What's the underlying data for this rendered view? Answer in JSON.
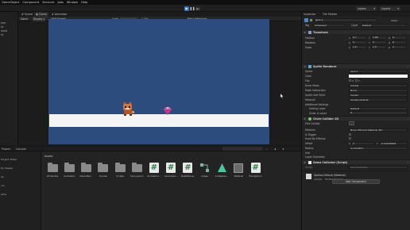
{
  "menubar": [
    "GameObject",
    "Component",
    "Services",
    "Jobs",
    "Window",
    "Help"
  ],
  "toolbar": {
    "layers": "Layers",
    "layout": "Layout",
    "play": "▶",
    "pause": "❚❚",
    "step": "▶|"
  },
  "hierarchy": {
    "items": [
      "ene",
      "ra",
      "ound",
      "ht"
    ]
  },
  "scene": {
    "tabs": [
      {
        "label": "Scene",
        "icon": "#"
      },
      {
        "label": "Game",
        "icon": "◉"
      },
      {
        "label": "Animator",
        "icon": "≣"
      }
    ],
    "game_bar": {
      "display": "Game",
      "display_num": "Display 1",
      "aspect": "16:9 Aspect",
      "scale_label": "Scale",
      "scale_value": "1.25x",
      "play_mode": "Play Unfocused"
    }
  },
  "project": {
    "tabs": [
      "Project",
      "Console"
    ],
    "left_items": [
      "Project Trailer",
      "Dy Sleeps",
      "lar",
      "ors",
      "jects"
    ],
    "breadcrumb": "Assets",
    "assets": [
      {
        "label": "2D Sprites",
        "kind": "folder"
      },
      {
        "label": "Animation",
        "kind": "folder"
      },
      {
        "label": "Dave Bed...",
        "kind": "folder"
      },
      {
        "label": "Scenes",
        "kind": "folder"
      },
      {
        "label": "Scripts",
        "kind": "folder"
      },
      {
        "label": "SunnyLand...",
        "kind": "folder"
      },
      {
        "label": "Animation...",
        "kind": "script"
      },
      {
        "label": "CameraCo...",
        "kind": "script"
      },
      {
        "label": "DeathZone...",
        "kind": "script"
      },
      {
        "label": "Grape",
        "kind": "graph"
      },
      {
        "label": "Instaglass...",
        "kind": "triangle"
      },
      {
        "label": "Material",
        "kind": "material"
      },
      {
        "label": "TriangleCol...",
        "kind": "script"
      }
    ]
  },
  "inspector": {
    "tabs": [
      "Inspector",
      "Tile Palette"
    ],
    "object_name": "gem 1",
    "static_label": "Static",
    "tag_label": "Tag",
    "tag_value": "Untagged",
    "layer_label": "Layer",
    "layer_value": "Default",
    "transform": {
      "title": "Transform",
      "rows": [
        {
          "label": "Position",
          "x": "6.7",
          "y": "1.88",
          "z": "0"
        },
        {
          "label": "Rotation",
          "x": "0",
          "y": "0",
          "z": "0"
        },
        {
          "label": "Scale",
          "x": "1.5",
          "y": "1.5",
          "z": "1"
        }
      ]
    },
    "sprite_renderer": {
      "title": "Sprite Renderer",
      "sprite_label": "Sprite",
      "sprite_value": "gem-1",
      "color_label": "Color",
      "flip_label": "Flip",
      "flip_x": "X",
      "flip_y": "Y",
      "draw_mode_label": "Draw Mode",
      "draw_mode_value": "Simple",
      "mask_label": "Mask Interaction",
      "mask_value": "None",
      "sort_point_label": "Sprite Sort Point",
      "sort_point_value": "Center",
      "material_label": "Material",
      "material_value": "Sprites-Default",
      "additional_label": "Additional Settings",
      "sorting_layer_label": "Sorting Layer",
      "sorting_layer_value": "Default",
      "order_label": "Order in Layer",
      "order_value": "0"
    },
    "circle_collider": {
      "title": "Circle Collider 2D",
      "edit_label": "Edit Collider",
      "material_label": "Material",
      "material_value": "None (Physics Material 2D)",
      "trigger_label": "Is Trigger",
      "effector_label": "Used By Effector",
      "offset_label": "Offset",
      "offset_x": "0",
      "offset_y": "-0.04204818",
      "radius_label": "Radius",
      "radius_value": "0.1479307",
      "info_label": "Info",
      "layer_overrides_label": "Layer Overrides"
    },
    "script": {
      "title": "Gems Collector (Script)",
      "script_label": "Script",
      "script_value": "GemsCollector"
    },
    "material_preview": {
      "name": "Sprites-Default (Material)",
      "shader_label": "Shader",
      "shader_value": "Sprites/Default"
    },
    "add_component": "Add Component"
  },
  "colors": {
    "game_bg": "#2c4c7d",
    "ground": "#f4f4f4",
    "accent": "#3a6fb0",
    "script_green": "#2f7d4a"
  }
}
